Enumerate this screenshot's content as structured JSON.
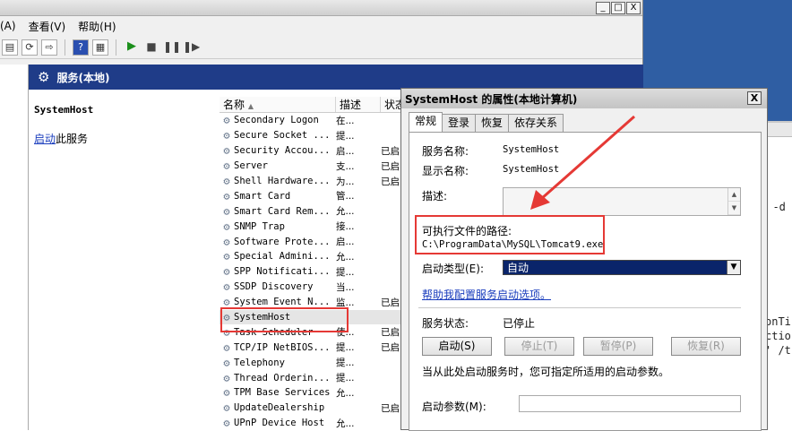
{
  "menu": {
    "action": "(A)",
    "view": "查看(V)",
    "help": "帮助(H)"
  },
  "window": {
    "min": "_",
    "max": "□",
    "close": "X"
  },
  "content": {
    "header": "服务(本地)",
    "selected_service": "SystemHost",
    "start_link": "启动",
    "start_suffix": "此服务"
  },
  "list": {
    "col_name": "名称",
    "col_desc": "描述",
    "col_status": "状态",
    "rows": [
      {
        "name": "Secondary Logon",
        "desc": "在...",
        "status": ""
      },
      {
        "name": "Secure Socket ...",
        "desc": "提...",
        "status": ""
      },
      {
        "name": "Security Accou...",
        "desc": "启...",
        "status": "已启"
      },
      {
        "name": "Server",
        "desc": "支...",
        "status": "已启"
      },
      {
        "name": "Shell Hardware...",
        "desc": "为...",
        "status": "已启"
      },
      {
        "name": "Smart Card",
        "desc": "管...",
        "status": ""
      },
      {
        "name": "Smart Card Rem...",
        "desc": "允...",
        "status": ""
      },
      {
        "name": "SNMP Trap",
        "desc": "接...",
        "status": ""
      },
      {
        "name": "Software Prote...",
        "desc": "启...",
        "status": ""
      },
      {
        "name": "Special Admini...",
        "desc": "允...",
        "status": ""
      },
      {
        "name": "SPP Notificati...",
        "desc": "提...",
        "status": ""
      },
      {
        "name": "SSDP Discovery",
        "desc": "当...",
        "status": ""
      },
      {
        "name": "System Event N...",
        "desc": "监...",
        "status": "已启"
      },
      {
        "name": "SystemHost",
        "desc": "",
        "status": ""
      },
      {
        "name": "Task Scheduler",
        "desc": "使...",
        "status": "已启"
      },
      {
        "name": "TCP/IP NetBIOS...",
        "desc": "提...",
        "status": "已启"
      },
      {
        "name": "Telephony",
        "desc": "提...",
        "status": ""
      },
      {
        "name": "Thread Orderin...",
        "desc": "提...",
        "status": ""
      },
      {
        "name": "TPM Base Services",
        "desc": "允...",
        "status": ""
      },
      {
        "name": "UpdateDealership",
        "desc": "",
        "status": "已启"
      },
      {
        "name": "UPnP Device Host",
        "desc": "允...",
        "status": ""
      }
    ]
  },
  "dialog": {
    "title": "SystemHost 的属性(本地计算机)",
    "close": "X",
    "tabs": [
      "常规",
      "登录",
      "恢复",
      "依存关系"
    ],
    "service_name_label": "服务名称:",
    "service_name": "SystemHost",
    "display_name_label": "显示名称:",
    "display_name": "SystemHost",
    "desc_label": "描述:",
    "path_label": "可执行文件的路径:",
    "path": "C:\\ProgramData\\MySQL\\Tomcat9.exe",
    "startup_label": "启动类型(E):",
    "startup_value": "自动",
    "help_link": "帮助我配置服务启动选项。",
    "status_label": "服务状态:",
    "status_value": "已停止",
    "buttons": [
      "启动(S)",
      "停止(T)",
      "暂停(P)",
      "恢复(R)"
    ],
    "hint": "当从此处启动服务时，您可指定所适用的启动参数。",
    "param_label": "启动参数(M):"
  },
  "background": {
    "t1": "k -d",
    "t2": "onTi",
    "t3": "ctio",
    "t4": "' /t"
  },
  "colors": {
    "header_band": "#1f3c88",
    "highlight_box": "#e53935",
    "link": "#1a3dbd"
  }
}
